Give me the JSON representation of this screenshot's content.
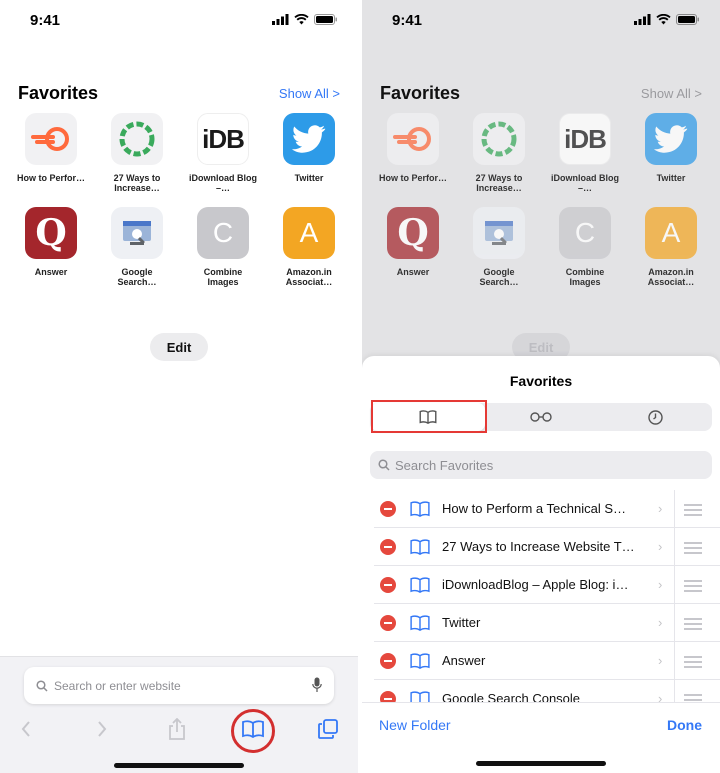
{
  "status": {
    "time": "9:41"
  },
  "favorites_header": {
    "title": "Favorites",
    "show_all": "Show All >"
  },
  "tiles": [
    {
      "label": "How to Perfor…",
      "icon": "semrush-logo-icon"
    },
    {
      "label": "27 Ways to Increase…",
      "icon": "ring-logo-icon"
    },
    {
      "label": "iDownload Blog –…",
      "icon": "idb-logo-icon",
      "glyph": "iDB"
    },
    {
      "label": "Twitter",
      "icon": "twitter-bird-icon"
    },
    {
      "label": "Answer",
      "icon": "quora-logo-icon",
      "glyph": "Q"
    },
    {
      "label": "Google Search…",
      "icon": "search-console-icon"
    },
    {
      "label": "Combine Images",
      "icon": "letter-c-icon",
      "glyph": "C"
    },
    {
      "label": "Amazon.in Associat…",
      "icon": "letter-a-icon",
      "glyph": "A"
    }
  ],
  "edit_label": "Edit",
  "address_bar": {
    "placeholder": "Search or enter website"
  },
  "sheet": {
    "title": "Favorites",
    "tabs": [
      "bookmarks",
      "reading-list",
      "history"
    ],
    "search_placeholder": "Search Favorites",
    "items": [
      "How to Perform a Technical S…",
      "27 Ways to Increase Website T…",
      "iDownloadBlog – Apple Blog: i…",
      "Twitter",
      "Answer",
      "Google Search Console"
    ],
    "new_folder": "New Folder",
    "done": "Done"
  },
  "colors": {
    "accent": "#3478f6",
    "highlight": "#e53935",
    "delete": "#e5483d"
  }
}
